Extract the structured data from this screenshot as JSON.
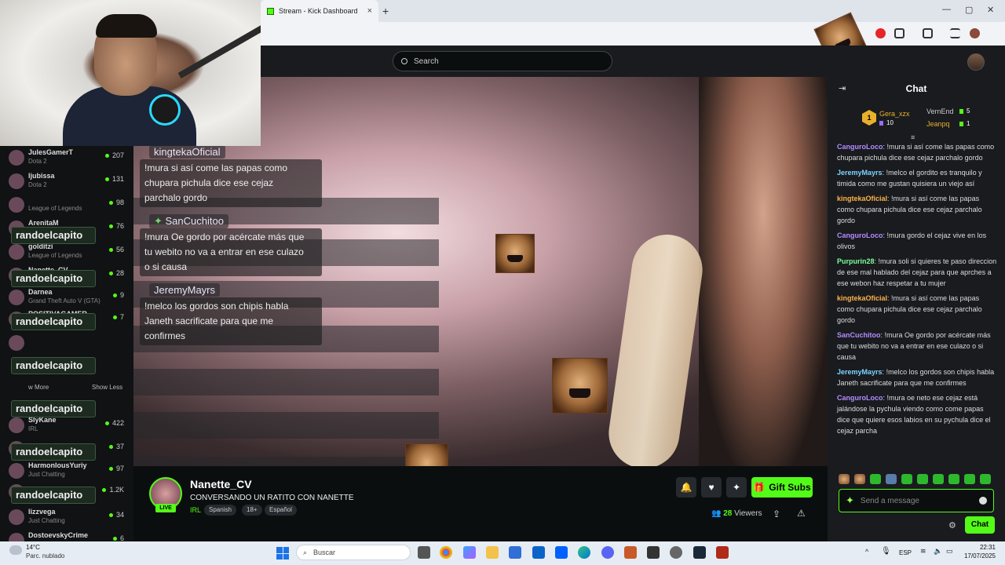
{
  "browser": {
    "tab_title": "Stream - Kick Dashboard",
    "close_tab": "×",
    "new_tab": "+",
    "minimize": "—",
    "maximize": "▢",
    "close_window": "✕"
  },
  "header": {
    "search_placeholder": "Search"
  },
  "sidebar": {
    "channels": [
      {
        "name": "JulesGamerT",
        "category": "Dota 2",
        "viewers": "207"
      },
      {
        "name": "ljubissa",
        "category": "Dota 2",
        "viewers": "131"
      },
      {
        "name": "",
        "category": "League of Legends",
        "viewers": "98"
      },
      {
        "name": "ArenitaM",
        "category": "",
        "viewers": "76"
      },
      {
        "name": "golditzi",
        "category": "League of Legends",
        "viewers": "56"
      },
      {
        "name": "Nanette_CV",
        "category": "",
        "viewers": "28"
      },
      {
        "name": "Darnea",
        "category": "Grand Theft Auto V (GTA)",
        "viewers": "9"
      },
      {
        "name": "POSITIVAGAMER",
        "category": "",
        "viewers": "7"
      },
      {
        "name": "",
        "category": "",
        "viewers": ""
      },
      {
        "name": "SlyKane",
        "category": "IRL",
        "viewers": "422"
      },
      {
        "name": "",
        "category": "",
        "viewers": "37"
      },
      {
        "name": "HarmonlousYuriy",
        "category": "Just Chatting",
        "viewers": "97"
      },
      {
        "name": "",
        "category": "",
        "viewers": "1.2K"
      },
      {
        "name": "lizzvega",
        "category": "Just Chatting",
        "viewers": "34"
      },
      {
        "name": "DostoevskyCrime",
        "category": "",
        "viewers": "6"
      }
    ],
    "overlay_name": "randoelcapito",
    "show_more": "w More",
    "show_less": "Show Less"
  },
  "overlay_chat": [
    {
      "user": "kingtekaOficial",
      "text_lines": [
        "!mura si así come las papas como",
        "chupara pichula dice ese cejaz",
        "parchalo gordo"
      ]
    },
    {
      "user": "SanCuchitoo",
      "text_lines": [
        "!mura Oe gordo por acércate más que",
        "tu webito no va a entrar en ese culazo",
        "o si causa"
      ]
    },
    {
      "user": "JeremyMayrs",
      "text_lines": [
        "!melco los gordos son chipis habla",
        "Janeth sacrificate para que me",
        "confirmes"
      ]
    }
  ],
  "stream": {
    "streamer": "Nanette_CV",
    "title": "CONVERSANDO UN RATITO CON NANETTE",
    "category": "IRL",
    "live_label": "LIVE",
    "tags": [
      "Spanish",
      "18+",
      "Español"
    ],
    "gift_label": "Gift Subs",
    "viewer_count": "28",
    "viewers_label": "Viewers"
  },
  "chat": {
    "title": "Chat",
    "leaderboard": [
      {
        "rank": "1",
        "name": "Gera_xzx",
        "count": "10"
      },
      {
        "name": "VernEnd",
        "count": "5"
      },
      {
        "name": "Jeanpq",
        "count": "1"
      }
    ],
    "messages": [
      {
        "user": "CanguroLoco",
        "color": "#b48cff",
        "text": "!mura si así come las papas como chupara pichula dice ese cejaz parchalo gordo"
      },
      {
        "user": "JeremyMayrs",
        "color": "#7fd4ff",
        "text": "!melco el gordito es tranquilo y timida como me gustan quisiera un viejo así"
      },
      {
        "user": "kingtekaOficial",
        "color": "#ffb347",
        "text": "!mura si así come las papas como chupara pichula dice ese cejaz parchalo gordo"
      },
      {
        "user": "CanguroLoco",
        "color": "#b48cff",
        "text": "!mura gordo el cejaz vive en los olivos"
      },
      {
        "user": "Purpurin28",
        "color": "#7dff9a",
        "text": "!mura soli si quieres te paso direccion de ese mal hablado del cejaz para que aprches a ese webon haz respetar a tu mujer"
      },
      {
        "user": "kingtekaOficial",
        "color": "#ffb347",
        "text": "!mura si así come las papas como chupara pichula dice ese cejaz parchalo gordo"
      },
      {
        "user": "SanCuchitoo",
        "color": "#b48cff",
        "text": "!mura Oe gordo por acércate más que tu webito no va a entrar en ese culazo o si causa"
      },
      {
        "user": "JeremyMayrs",
        "color": "#7fd4ff",
        "text": "!melco los gordos son chipis habla Janeth sacrificate para que me confirmes"
      },
      {
        "user": "CanguroLoco",
        "color": "#b48cff",
        "text": "!mura oe neto ese cejaz está jalándose la pychula viendo como come papas dice que quiere esos labios en su pychula dice el cejaz parcha"
      }
    ],
    "input_placeholder": "Send a message",
    "send_label": "Chat"
  },
  "taskbar": {
    "temperature": "14°C",
    "weather": "Parc. nublado",
    "search_placeholder": "Buscar",
    "language": "ESP",
    "time": "22:31",
    "date": "17/07/2025"
  }
}
